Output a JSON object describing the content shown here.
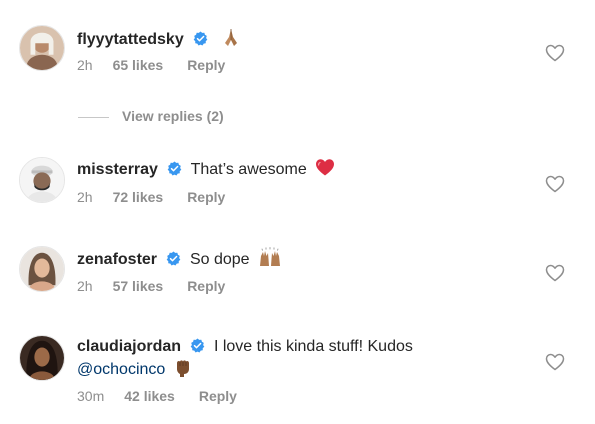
{
  "comments": [
    {
      "username": "flyyytattedsky",
      "text": "",
      "mention": "",
      "emoji": "folded-hands",
      "time": "2h",
      "likes": "65 likes",
      "reply": "Reply"
    },
    {
      "username": "missterray",
      "text": "That’s awesome",
      "mention": "",
      "emoji": "red-heart",
      "time": "2h",
      "likes": "72 likes",
      "reply": "Reply"
    },
    {
      "username": "zenafoster",
      "text": "So dope",
      "mention": "",
      "emoji": "raising-hands",
      "time": "2h",
      "likes": "57 likes",
      "reply": "Reply"
    },
    {
      "username": "claudiajordan",
      "text": "I love this kinda stuff! Kudos",
      "mention": "@ochocinco",
      "emoji": "raised-fist",
      "time": "30m",
      "likes": "42 likes",
      "reply": "Reply"
    }
  ],
  "view_replies": {
    "label": "View replies (2)"
  },
  "colors": {
    "text": "#262626",
    "secondary": "#8e8e8e",
    "verified": "#3897f0",
    "mention": "#00376b",
    "heart_red": "#ed4956"
  },
  "icons": {
    "verified": "verified-badge-icon",
    "like": "heart-outline-icon"
  }
}
